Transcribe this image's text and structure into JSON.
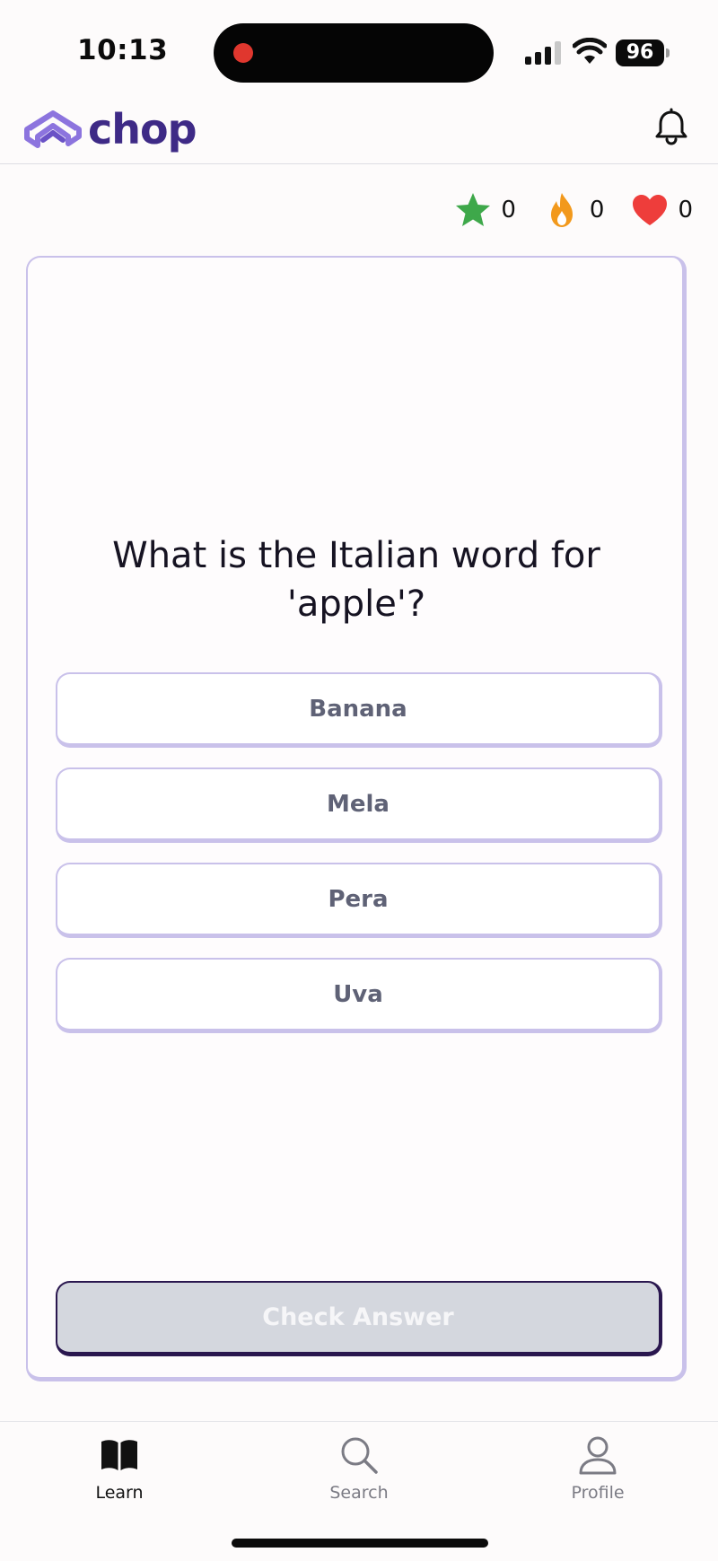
{
  "status_bar": {
    "time": "10:13",
    "battery": "96"
  },
  "header": {
    "brand": "chop",
    "brand_color": "#3e2a86",
    "logo_icon": "chop-logo-icon",
    "notification_icon": "bell-icon"
  },
  "stats": [
    {
      "icon": "star-icon",
      "value": "0",
      "color": "#3ea84a"
    },
    {
      "icon": "flame-icon",
      "value": "0",
      "color": "#f2991c"
    },
    {
      "icon": "heart-icon",
      "value": "0",
      "color": "#ee3d3b"
    }
  ],
  "quiz": {
    "question": "What is the Italian word for 'apple'?",
    "options": [
      "Banana",
      "Mela",
      "Pera",
      "Uva"
    ],
    "check_label": "Check Answer"
  },
  "nav": {
    "items": [
      {
        "label": "Learn",
        "icon": "book-icon",
        "active": true
      },
      {
        "label": "Search",
        "icon": "search-icon",
        "active": false
      },
      {
        "label": "Profile",
        "icon": "person-icon",
        "active": false
      }
    ]
  },
  "colors": {
    "accent_border": "#c9c1ea",
    "disabled_button": "#d4d7de",
    "option_text": "#5f6276"
  }
}
